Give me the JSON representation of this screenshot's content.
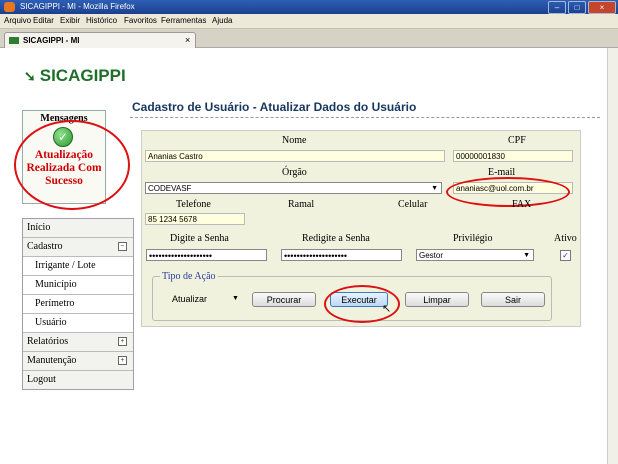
{
  "window": {
    "title": "SICAGIPPI - MI - Mozilla Firefox",
    "menu": [
      "Arquivo",
      "Editar",
      "Exibir",
      "Histórico",
      "Favoritos",
      "Ferramentas",
      "Ajuda"
    ],
    "tab_label": "SICAGIPPI - MI",
    "tab_close": "×",
    "controls": [
      "–",
      "□",
      "×"
    ]
  },
  "app": {
    "logo": "SICAGIPPI"
  },
  "messages": {
    "title": "Mensagens",
    "icon": "check-icon",
    "text": "Atualização Realizada Com Sucesso",
    "status_color": "#cc0000"
  },
  "sidemenu": {
    "items": [
      {
        "label": "Início"
      },
      {
        "label": "Cadastro",
        "expander": "−"
      },
      {
        "label": "Irrigante / Lote"
      },
      {
        "label": "Município"
      },
      {
        "label": "Perímetro"
      },
      {
        "label": "Usuário"
      },
      {
        "label": "Relatórios",
        "expander": "+"
      },
      {
        "label": "Manutenção",
        "expander": "+"
      },
      {
        "label": "Logout"
      }
    ]
  },
  "form": {
    "title": "Cadastro de Usuário - Atualizar Dados do Usuário",
    "labels": {
      "nome": "Nome",
      "cpf": "CPF",
      "orgao": "Órgão",
      "email": "E-mail",
      "telefone": "Telefone",
      "ramal": "Ramal",
      "celular": "Celular",
      "fax": "FAX",
      "senha": "Digite a Senha",
      "resenha": "Redigite a Senha",
      "privilegio": "Privilégio",
      "ativo": "Ativo"
    },
    "values": {
      "nome": "Ananias Castro",
      "cpf": "00000001830",
      "orgao": "CODEVASF",
      "email": "ananiasc@uol.com.br",
      "telefone": "85 1234 5678",
      "ramal": "",
      "celular": "",
      "fax": "",
      "senha": "••••••••••••••••••••",
      "resenha": "••••••••••••••••••••",
      "privilegio": "Gestor",
      "ativo_checked": true
    },
    "acao": {
      "legend": "Tipo de Ação",
      "selected": "Atualizar",
      "buttons": {
        "procurar": "Procurar",
        "executar": "Executar",
        "limpar": "Limpar",
        "sair": "Sair"
      }
    }
  },
  "colors": {
    "brand": "#1f6f2a",
    "form_bg": "#f0f2dd",
    "highlight": "#d11111"
  }
}
